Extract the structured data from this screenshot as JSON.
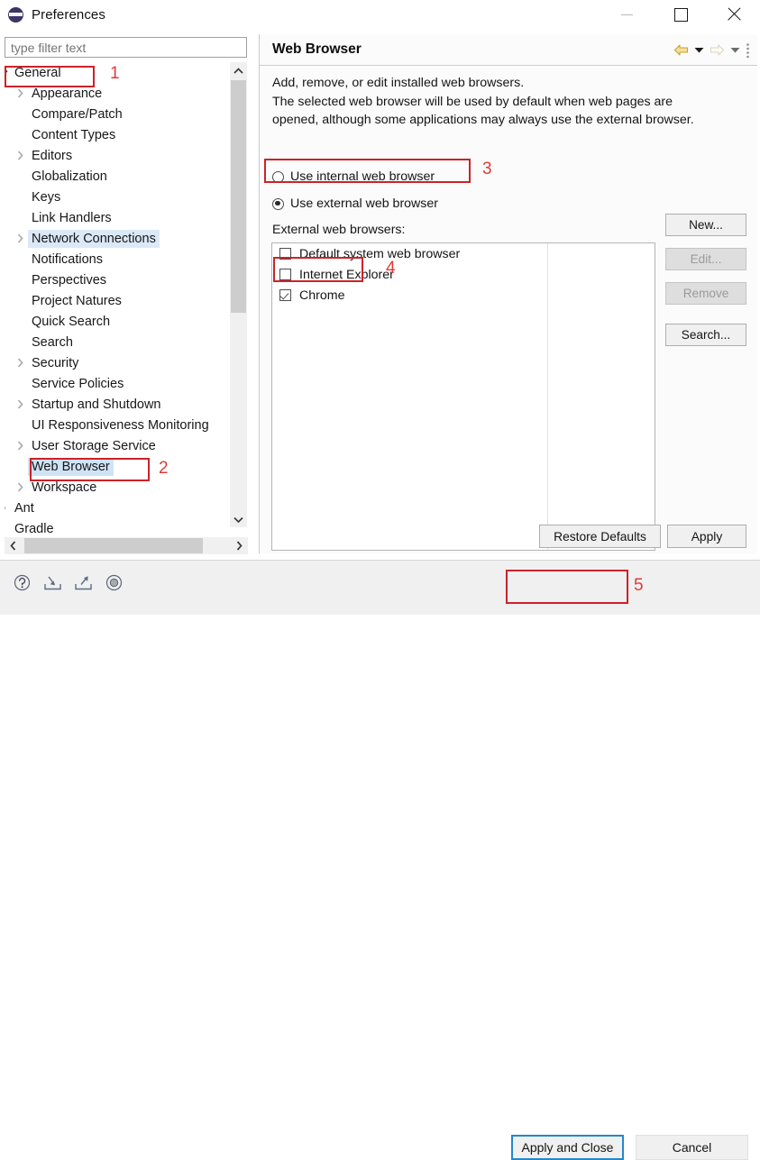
{
  "window": {
    "title": "Preferences",
    "app_icon": "eclipse-icon",
    "minimize_label": "Minimize",
    "maximize_label": "Maximize",
    "close_label": "Close"
  },
  "filter": {
    "placeholder": "type filter text",
    "value": ""
  },
  "tree": {
    "items": [
      {
        "label": "General",
        "depth": 0,
        "arrow": "chevron-down",
        "state": "expanded"
      },
      {
        "label": "Appearance",
        "depth": 1,
        "arrow": "chevron-right",
        "state": "collapsed"
      },
      {
        "label": "Compare/Patch",
        "depth": 1,
        "arrow": "none",
        "state": "leaf"
      },
      {
        "label": "Content Types",
        "depth": 1,
        "arrow": "none",
        "state": "leaf"
      },
      {
        "label": "Editors",
        "depth": 1,
        "arrow": "chevron-right",
        "state": "collapsed"
      },
      {
        "label": "Globalization",
        "depth": 1,
        "arrow": "none",
        "state": "leaf"
      },
      {
        "label": "Keys",
        "depth": 1,
        "arrow": "none",
        "state": "leaf"
      },
      {
        "label": "Link Handlers",
        "depth": 1,
        "arrow": "none",
        "state": "leaf"
      },
      {
        "label": "Network Connections",
        "depth": 1,
        "arrow": "chevron-right",
        "state": "hover"
      },
      {
        "label": "Notifications",
        "depth": 1,
        "arrow": "none",
        "state": "leaf"
      },
      {
        "label": "Perspectives",
        "depth": 1,
        "arrow": "none",
        "state": "leaf"
      },
      {
        "label": "Project Natures",
        "depth": 1,
        "arrow": "none",
        "state": "leaf"
      },
      {
        "label": "Quick Search",
        "depth": 1,
        "arrow": "none",
        "state": "leaf"
      },
      {
        "label": "Search",
        "depth": 1,
        "arrow": "none",
        "state": "leaf"
      },
      {
        "label": "Security",
        "depth": 1,
        "arrow": "chevron-right",
        "state": "collapsed"
      },
      {
        "label": "Service Policies",
        "depth": 1,
        "arrow": "none",
        "state": "leaf"
      },
      {
        "label": "Startup and Shutdown",
        "depth": 1,
        "arrow": "chevron-right",
        "state": "collapsed"
      },
      {
        "label": "UI Responsiveness Monitoring",
        "depth": 1,
        "arrow": "none",
        "state": "leaf"
      },
      {
        "label": "User Storage Service",
        "depth": 1,
        "arrow": "chevron-right",
        "state": "collapsed"
      },
      {
        "label": "Web Browser",
        "depth": 1,
        "arrow": "none",
        "state": "selected"
      },
      {
        "label": "Workspace",
        "depth": 1,
        "arrow": "chevron-right",
        "state": "collapsed"
      },
      {
        "label": "Ant",
        "depth": 0,
        "arrow": "chevron-right",
        "state": "collapsed"
      },
      {
        "label": "Gradle",
        "depth": 0,
        "arrow": "none",
        "state": "leaf"
      }
    ]
  },
  "page": {
    "title": "Web Browser",
    "description_lines": [
      "Add, remove, or edit installed web browsers.",
      "The selected web browser will be used by default when web pages are",
      "opened, although some applications may always use the external browser."
    ],
    "radios": [
      {
        "label": "Use internal web browser",
        "selected": false
      },
      {
        "label": "Use external web browser",
        "selected": true
      }
    ],
    "list_label": "External web browsers:",
    "browsers": [
      {
        "label": "Default system web browser",
        "checked": false
      },
      {
        "label": "Internet Explorer",
        "checked": false
      },
      {
        "label": "Chrome",
        "checked": true
      }
    ],
    "side_buttons": [
      {
        "label": "New...",
        "enabled": true
      },
      {
        "label": "Edit...",
        "enabled": false
      },
      {
        "label": "Remove",
        "enabled": false
      },
      {
        "label": "Search...",
        "enabled": true
      }
    ],
    "restore_defaults_label": "Restore Defaults",
    "apply_label": "Apply"
  },
  "header_tools": {
    "back_icon": "back-arrow-icon",
    "back_menu_icon": "chevron-down-icon",
    "forward_icon": "forward-arrow-icon",
    "forward_menu_icon": "chevron-down-icon",
    "menu_icon": "vertical-dots-icon"
  },
  "footer": {
    "icons": [
      {
        "name": "help-icon"
      },
      {
        "name": "import-icon"
      },
      {
        "name": "export-icon"
      },
      {
        "name": "record-icon"
      }
    ],
    "apply_and_close_label": "Apply and Close",
    "cancel_label": "Cancel"
  },
  "annotations": {
    "n1": "1",
    "n2": "2",
    "n3": "3",
    "n4": "4",
    "n5": "5",
    "color": "#cc2229"
  }
}
